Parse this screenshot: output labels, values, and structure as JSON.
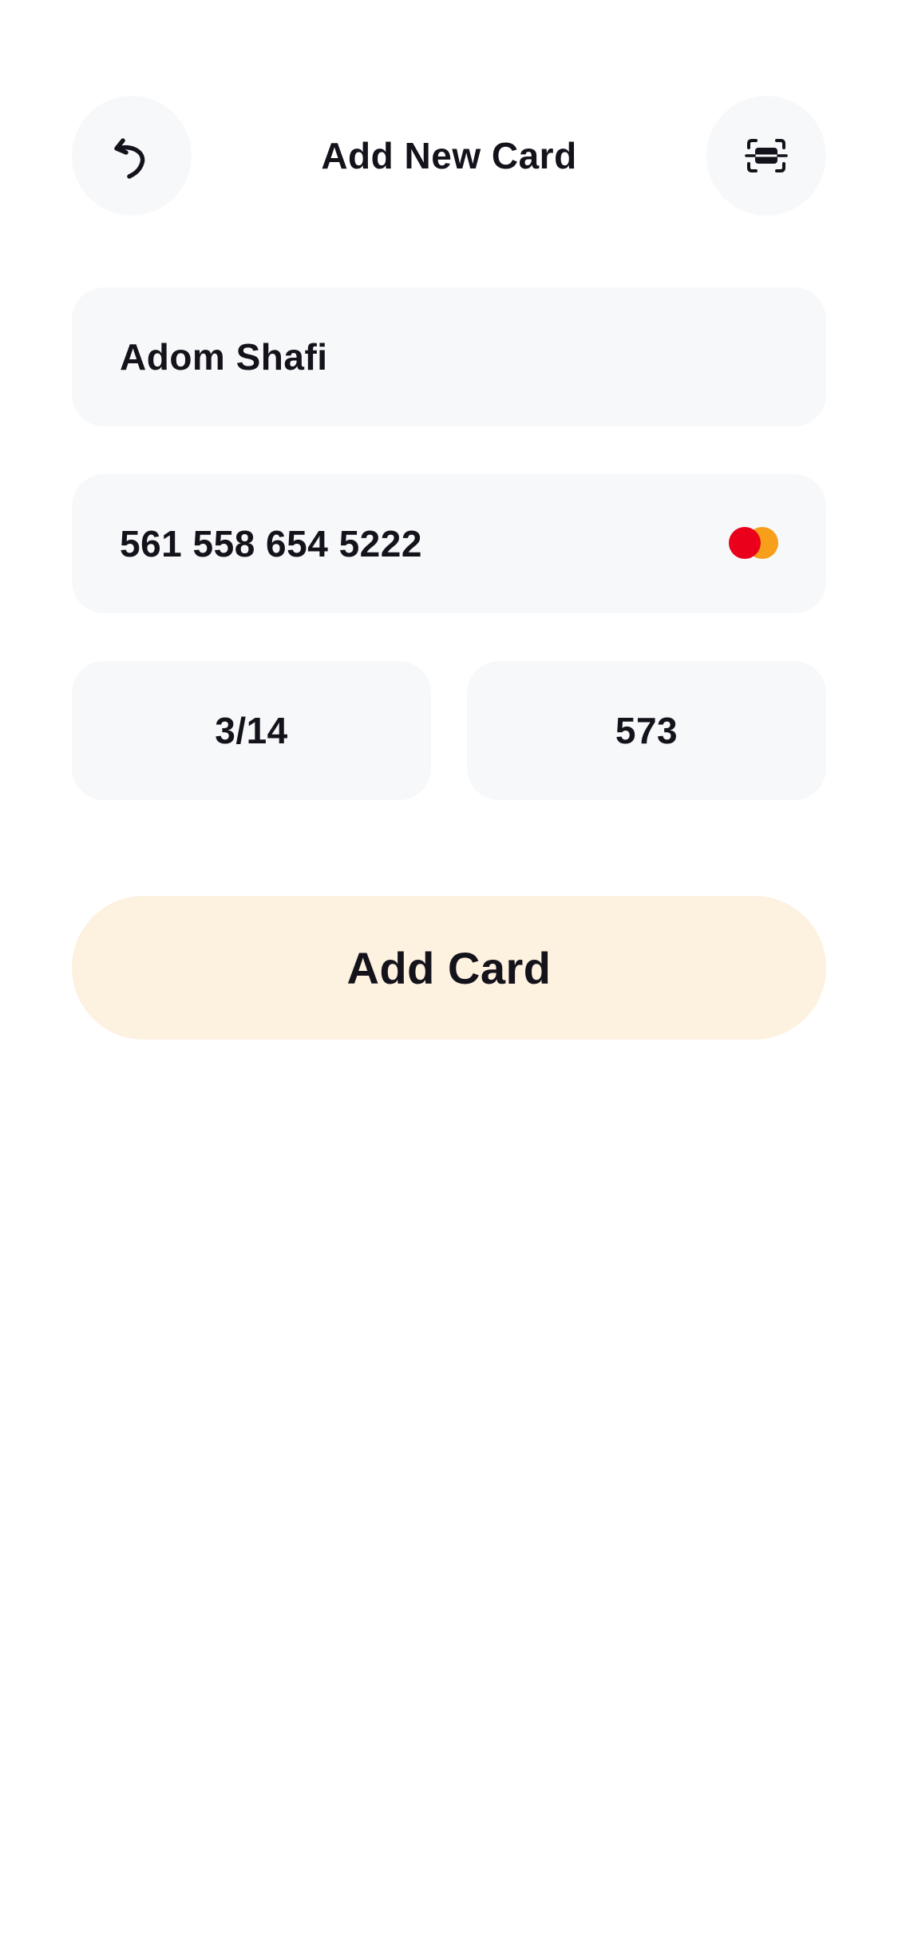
{
  "header": {
    "title": "Add New Card",
    "back_icon": "undo-arrow-icon",
    "scan_icon": "scan-card-icon"
  },
  "form": {
    "cardholder_name": "Adom Shafi",
    "card_number": "561 558 654 5222",
    "card_brand_icon": "mastercard-logo-icon",
    "expiry": "3/14",
    "cvv": "573"
  },
  "actions": {
    "add_card_label": "Add Card"
  },
  "colors": {
    "field_bg": "#f7f8fa",
    "button_bg": "#fdf1e0",
    "text": "#14121a",
    "mastercard_red": "#eb001b",
    "mastercard_orange": "#f79e1b"
  }
}
